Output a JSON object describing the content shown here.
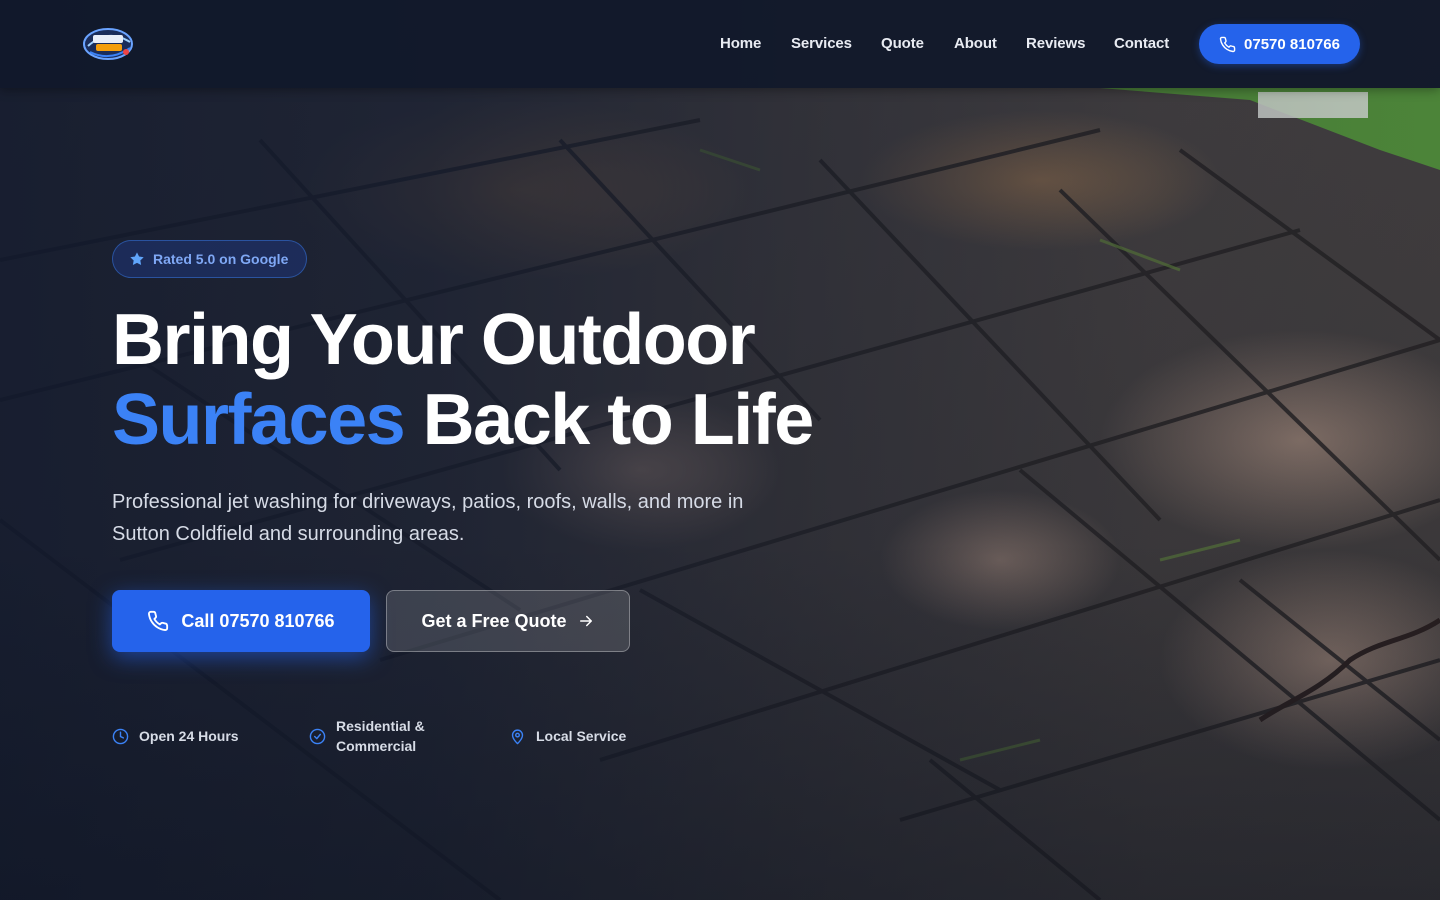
{
  "header": {
    "logo_text": "POWER PULSE",
    "nav": [
      "Home",
      "Services",
      "Quote",
      "About",
      "Reviews",
      "Contact"
    ],
    "phone_label": "07570 810766"
  },
  "hero": {
    "badge": "Rated 5.0 on Google",
    "headline_line1": "Bring Your Outdoor",
    "headline_accent": "Surfaces",
    "headline_rest": " Back to Life",
    "subtext": "Professional jet washing for driveways, patios, roofs, walls, and more in Sutton Coldfield and surrounding areas.",
    "cta_call": "Call 07570 810766",
    "cta_quote": "Get a Free Quote",
    "features": [
      {
        "icon": "clock-icon",
        "label": "Open 24 Hours"
      },
      {
        "icon": "check-circle-icon",
        "label": "Residential & Commercial"
      },
      {
        "icon": "map-pin-icon",
        "label": "Local Service"
      }
    ]
  },
  "colors": {
    "accent": "#3b82f6",
    "button": "#2563eb",
    "header_bg": "#111a2e"
  }
}
